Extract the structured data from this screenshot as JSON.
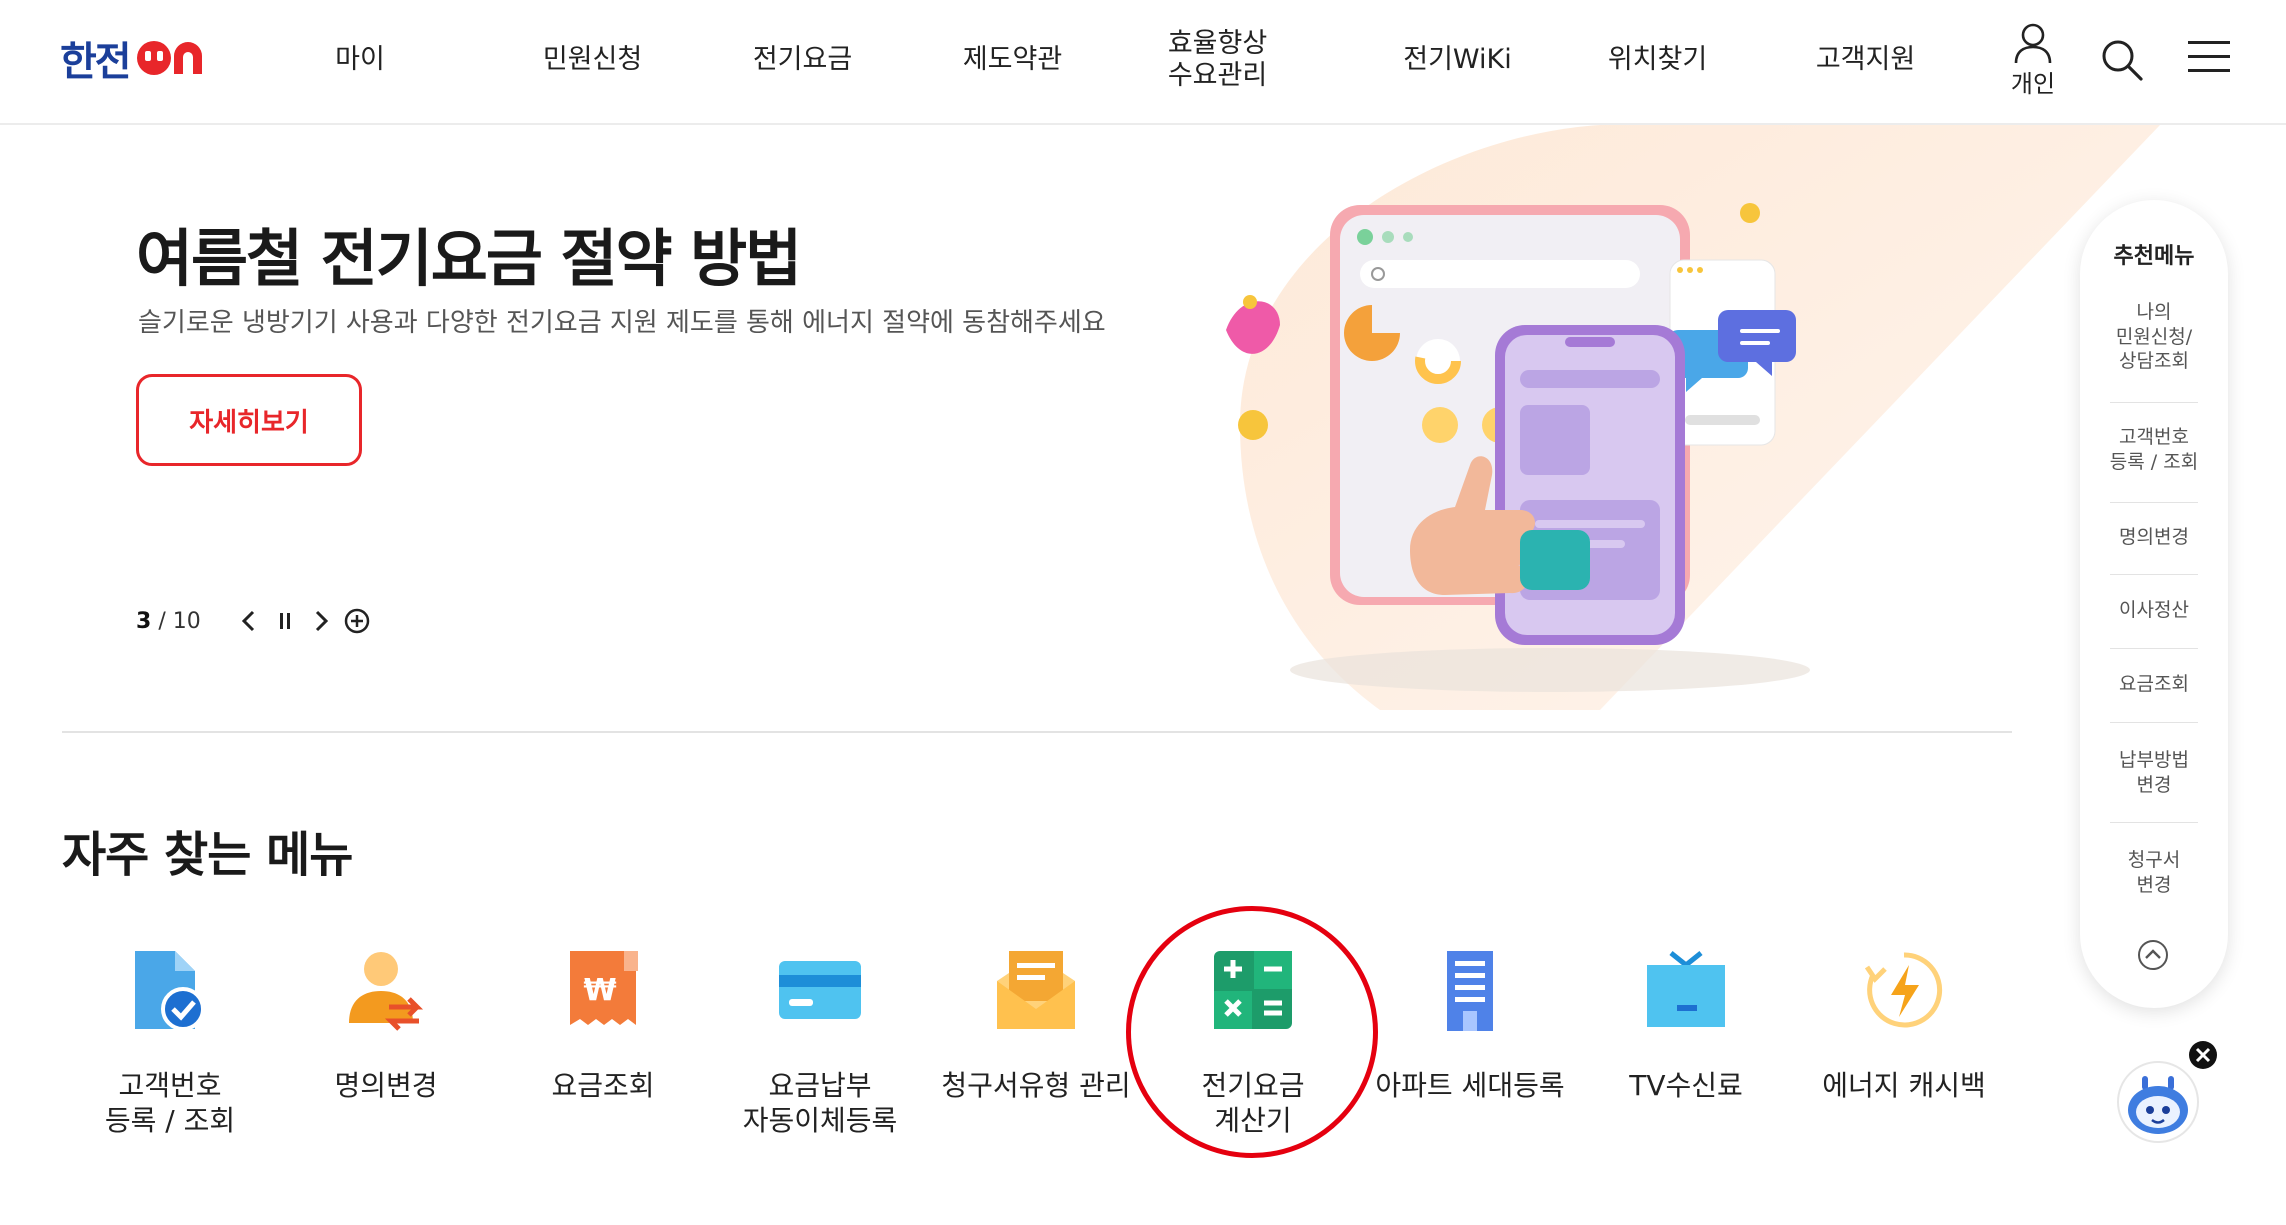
{
  "header": {
    "logo_text": "한전",
    "nav": [
      {
        "label": "마이"
      },
      {
        "label": "민원신청"
      },
      {
        "label": "전기요금"
      },
      {
        "label": "제도약관"
      },
      {
        "label": "효율향상\n수요관리"
      },
      {
        "label": "전기WiKi"
      },
      {
        "label": "위치찾기"
      },
      {
        "label": "고객지원"
      }
    ],
    "user_label": "개인",
    "icons": [
      "user-icon",
      "search-icon",
      "hamburger-menu-icon"
    ]
  },
  "hero": {
    "title": "여름철 전기요금 절약 방법",
    "subtitle": "슬기로운 냉방기기 사용과 다양한 전기요금 지원 제도를 통해 에너지 절약에 동참해주세요",
    "button_label": "자세히보기",
    "pager": {
      "current": "3",
      "total": "/ 10"
    }
  },
  "frequent": {
    "title_normal": "자주 찾는 ",
    "title_bold": "메뉴",
    "items": [
      {
        "label": "고객번호\n등록 / 조회",
        "icon": "document-check-icon"
      },
      {
        "label": "명의변경",
        "icon": "person-transfer-icon"
      },
      {
        "label": "요금조회",
        "icon": "won-receipt-icon"
      },
      {
        "label": "요금납부\n자동이체등록",
        "icon": "credit-card-icon"
      },
      {
        "label": "청구서유형 관리",
        "icon": "envelope-icon"
      },
      {
        "label": "전기요금\n계산기",
        "icon": "calculator-icon"
      },
      {
        "label": "아파트 세대등록",
        "icon": "apartment-icon"
      },
      {
        "label": "TV수신료",
        "icon": "tv-icon"
      },
      {
        "label": "에너지 캐시백",
        "icon": "energy-cashback-icon"
      }
    ]
  },
  "side_menu": {
    "title": "추천메뉴",
    "items": [
      {
        "label": "나의\n민원신청/\n상담조회"
      },
      {
        "label": "고객번호\n등록 / 조회"
      },
      {
        "label": "명의변경"
      },
      {
        "label": "이사정산"
      },
      {
        "label": "요금조회"
      },
      {
        "label": "납부방법\n변경"
      },
      {
        "label": "청구서\n변경"
      }
    ]
  },
  "colors": {
    "brand_blue": "#1b3f9a",
    "brand_red": "#e8262a",
    "highlight": "#e5000f"
  }
}
